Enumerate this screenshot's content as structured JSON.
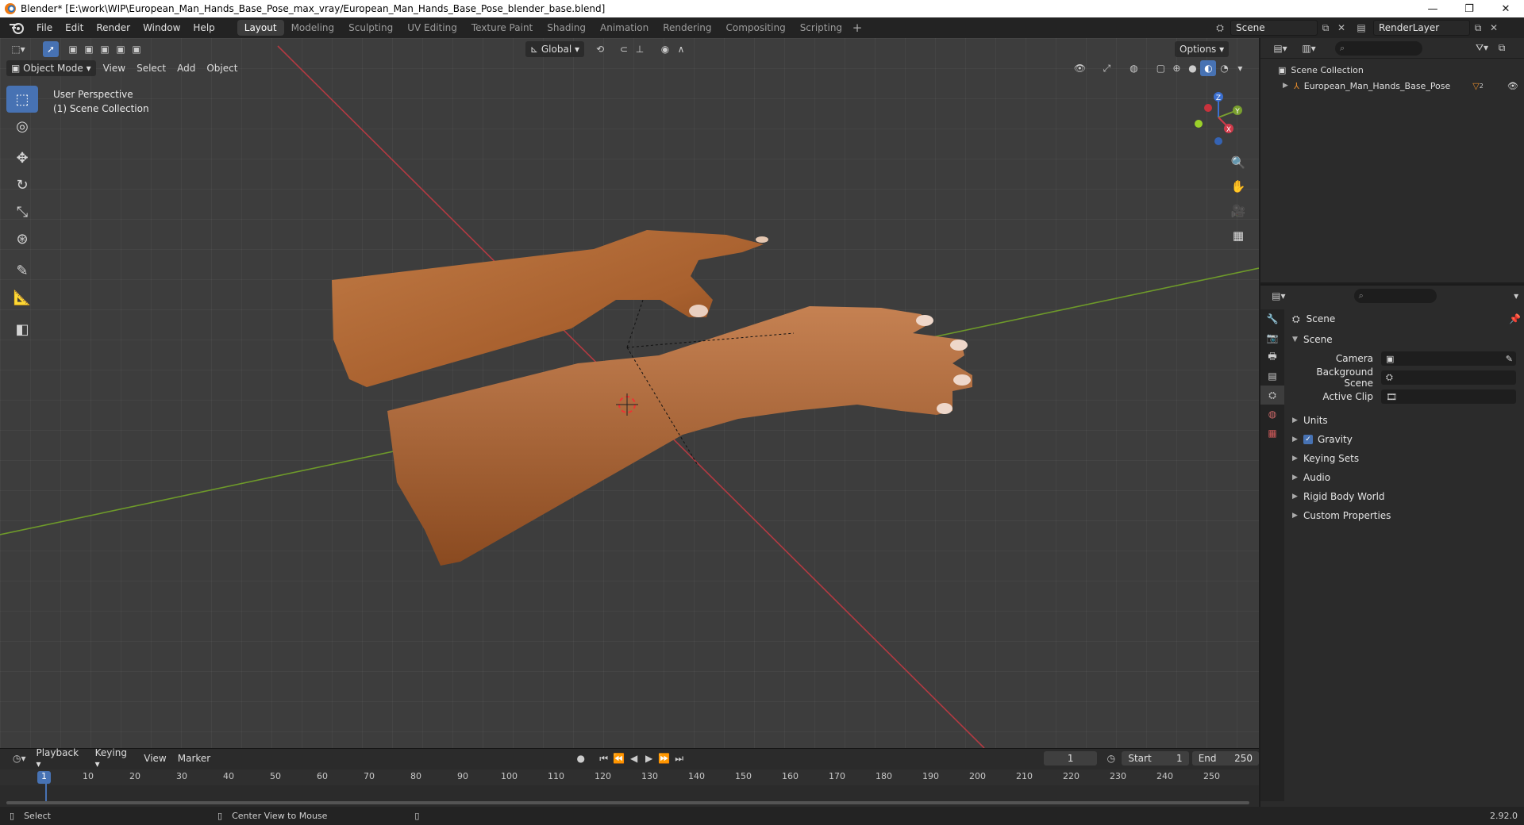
{
  "window": {
    "title": "Blender* [E:\\work\\WIP\\European_Man_Hands_Base_Pose_max_vray/European_Man_Hands_Base_Pose_blender_base.blend]",
    "minimize": "—",
    "maximize": "❐",
    "close": "✕"
  },
  "menu": {
    "items": [
      "File",
      "Edit",
      "Render",
      "Window",
      "Help"
    ]
  },
  "workspaces": {
    "tabs": [
      "Layout",
      "Modeling",
      "Sculpting",
      "UV Editing",
      "Texture Paint",
      "Shading",
      "Animation",
      "Rendering",
      "Compositing",
      "Scripting"
    ],
    "active": "Layout",
    "add": "+"
  },
  "scene_selector": {
    "scene": "Scene",
    "view_layer": "RenderLayer"
  },
  "viewport": {
    "mode": "Object Mode",
    "menus": [
      "View",
      "Select",
      "Add",
      "Object"
    ],
    "orientation": "Global",
    "options": "Options",
    "info_line1": "User Perspective",
    "info_line2": "(1) Scene Collection",
    "gizmo": {
      "x": "X",
      "y": "Y",
      "z": "Z"
    }
  },
  "outliner": {
    "collection": "Scene Collection",
    "object": "European_Man_Hands_Base_Pose",
    "badge": "2"
  },
  "properties": {
    "context": "Scene",
    "panel": "Scene",
    "camera_label": "Camera",
    "background_label": "Background Scene",
    "clip_label": "Active Clip",
    "sections": [
      "Units",
      "Gravity",
      "Keying Sets",
      "Audio",
      "Rigid Body World",
      "Custom Properties"
    ]
  },
  "timeline": {
    "menus": [
      "Playback",
      "Keying",
      "View",
      "Marker"
    ],
    "current_frame": "1",
    "start_label": "Start",
    "start": "1",
    "end_label": "End",
    "end": "250",
    "ticks": [
      "10",
      "20",
      "30",
      "40",
      "50",
      "60",
      "70",
      "80",
      "90",
      "100",
      "110",
      "120",
      "130",
      "140",
      "150",
      "160",
      "170",
      "180",
      "190",
      "200",
      "210",
      "220",
      "230",
      "240",
      "250"
    ]
  },
  "statusbar": {
    "left": "Select",
    "middle": "Center View to Mouse",
    "version": "2.92.0"
  },
  "colors": {
    "accent": "#4772b3",
    "x_axis": "#c8323c",
    "y_axis": "#6e9e28",
    "skin": "#b06a38"
  }
}
